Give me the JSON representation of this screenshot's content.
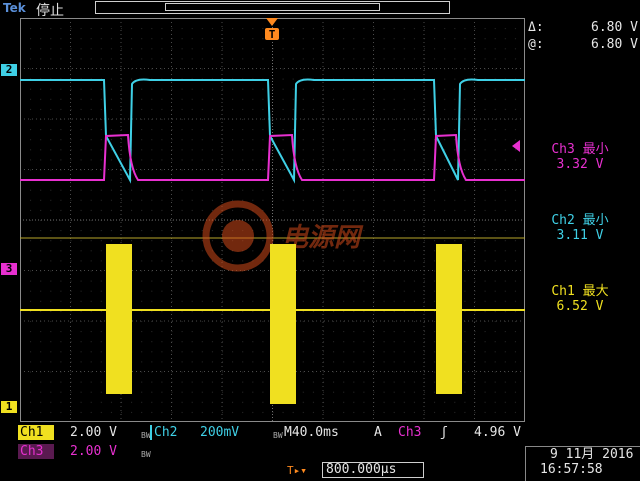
{
  "header": {
    "brand": "Tek",
    "status": "停止"
  },
  "cursors": {
    "delta_label": "Δ:",
    "delta_value": "6.80 V",
    "at_label": "@:",
    "at_value": "6.80 V"
  },
  "measurements": [
    {
      "label": "Ch3 最小",
      "value": "3.32 V",
      "color": "#e830d0"
    },
    {
      "label": "Ch2 最小",
      "value": "3.11 V",
      "color": "#3fd0e6"
    },
    {
      "label": "Ch1 最大",
      "value": "6.52 V",
      "color": "#f0e020"
    }
  ],
  "channel_markers": {
    "ch1": "1",
    "ch2": "2",
    "ch3": "3",
    "trigger": "T"
  },
  "channels": {
    "ch1": {
      "name": "Ch1",
      "scale": "2.00 V",
      "bw": "BW",
      "color": "#f0e020"
    },
    "ch2": {
      "name": "Ch2",
      "scale": "200mV",
      "bw": "BW",
      "color": "#3fd0e6"
    },
    "ch3": {
      "name": "Ch3",
      "scale": "2.00 V",
      "bw": "BW",
      "color": "#e830d0"
    }
  },
  "horizontal": {
    "timebase": "M40.0ms",
    "trigger_mode": "A",
    "trigger_source": "Ch3",
    "trigger_slope": "ʃ",
    "trigger_level": "4.96 V",
    "trigger_position": "800.000µs"
  },
  "datetime": {
    "date": "9 11月 2016",
    "time": "16:57:58"
  },
  "watermark": "电源网"
}
